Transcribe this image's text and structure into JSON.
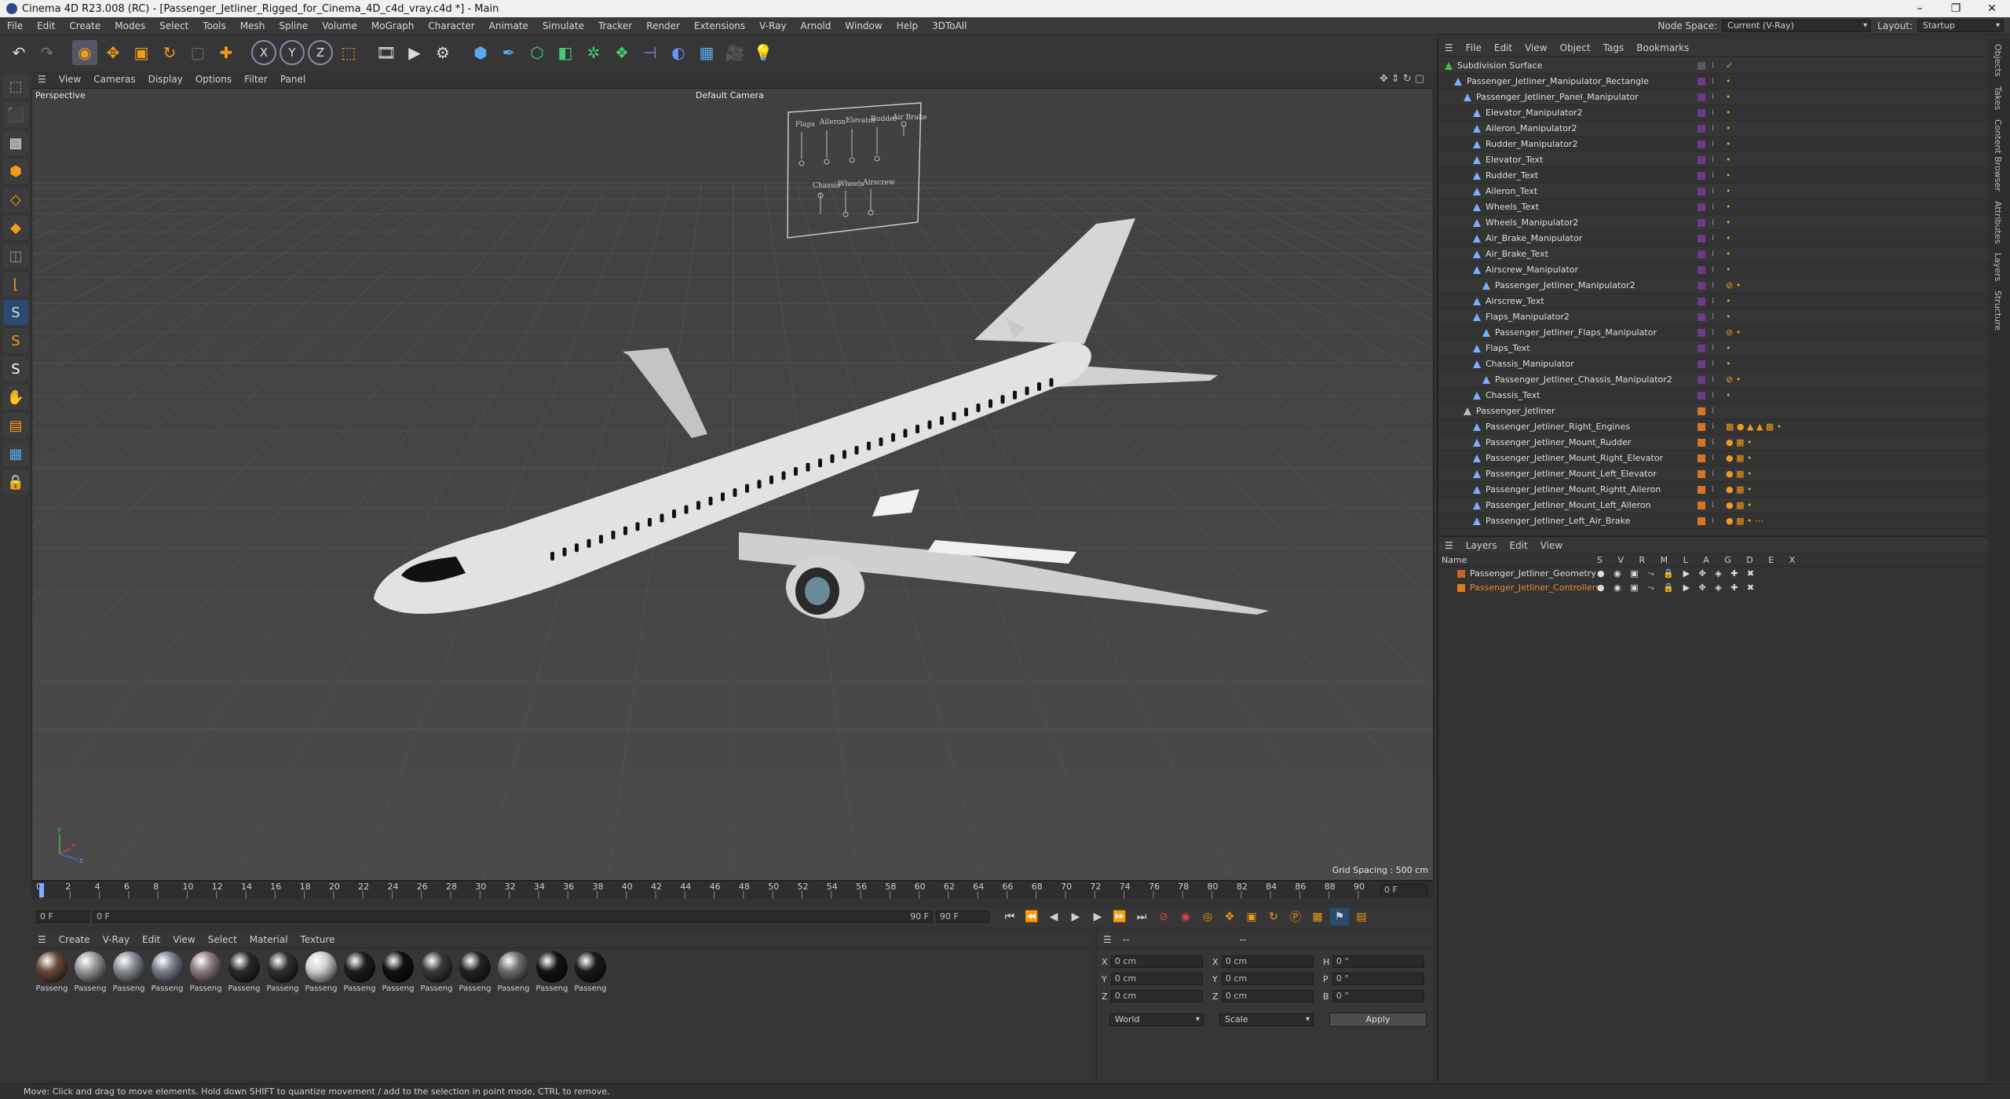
{
  "window": {
    "title": "Cinema 4D R23.008 (RC) - [Passenger_Jetliner_Rigged_for_Cinema_4D_c4d_vray.c4d *] - Main",
    "controls": [
      "–",
      "❐",
      "✕"
    ]
  },
  "menubar": {
    "items": [
      "File",
      "Edit",
      "Create",
      "Modes",
      "Select",
      "Tools",
      "Mesh",
      "Spline",
      "Volume",
      "MoGraph",
      "Character",
      "Animate",
      "Simulate",
      "Tracker",
      "Render",
      "Extensions",
      "V-Ray",
      "Arnold",
      "Window",
      "Help",
      "3DToAll"
    ],
    "node_space_label": "Node Space:",
    "node_space_value": "Current (V-Ray)",
    "layout_label": "Layout:",
    "layout_value": "Startup"
  },
  "viewport": {
    "menu": [
      "View",
      "Cameras",
      "Display",
      "Options",
      "Filter",
      "Panel"
    ],
    "mode": "Perspective",
    "camera": "Default Camera",
    "grid_spacing": "Grid Spacing : 500 cm",
    "panel_labels": [
      "Flaps",
      "Aileron",
      "Elevator",
      "Rudder",
      "Air Brake",
      "Chassis",
      "Wheels",
      "Airscrew"
    ]
  },
  "timeline": {
    "ticks": [
      "0",
      "2",
      "4",
      "6",
      "8",
      "10",
      "12",
      "14",
      "16",
      "18",
      "20",
      "22",
      "24",
      "26",
      "28",
      "30",
      "32",
      "34",
      "36",
      "38",
      "40",
      "42",
      "44",
      "46",
      "48",
      "50",
      "52",
      "54",
      "56",
      "58",
      "60",
      "62",
      "64",
      "66",
      "68",
      "70",
      "72",
      "74",
      "76",
      "78",
      "80",
      "82",
      "84",
      "86",
      "88",
      "90"
    ],
    "current_frame": "0 F",
    "start_field": "0 F",
    "preview_start": "0 F",
    "preview_end": "90 F",
    "end_field": "90 F"
  },
  "materials": {
    "menu": [
      "Create",
      "V-Ray",
      "Edit",
      "View",
      "Select",
      "Material",
      "Texture"
    ],
    "items": [
      {
        "label": "Passeng",
        "color": "#6a4a3c"
      },
      {
        "label": "Passeng",
        "color": "#9a9a9a"
      },
      {
        "label": "Passeng",
        "color": "#8a8e96"
      },
      {
        "label": "Passeng",
        "color": "#7c8290"
      },
      {
        "label": "Passeng",
        "color": "#8c7c80"
      },
      {
        "label": "Passeng",
        "color": "#2a2a2a"
      },
      {
        "label": "Passeng",
        "color": "#303030"
      },
      {
        "label": "Passeng",
        "color": "#cfcfcf"
      },
      {
        "label": "Passeng",
        "color": "#1e1e1e"
      },
      {
        "label": "Passeng",
        "color": "#101010"
      },
      {
        "label": "Passeng",
        "color": "#3a3a3a"
      },
      {
        "label": "Passeng",
        "color": "#242424"
      },
      {
        "label": "Passeng",
        "color": "#6e6e6e"
      },
      {
        "label": "Passeng",
        "color": "#141414"
      },
      {
        "label": "Passeng",
        "color": "#1a1a1a"
      }
    ]
  },
  "coordinates": {
    "header": "--",
    "header2": "--",
    "rows": [
      {
        "a1": "X",
        "v1": "0 cm",
        "a2": "X",
        "v2": "0 cm",
        "a3": "H",
        "v3": "0 °"
      },
      {
        "a1": "Y",
        "v1": "0 cm",
        "a2": "Y",
        "v2": "0 cm",
        "a3": "P",
        "v3": "0 °"
      },
      {
        "a1": "Z",
        "v1": "0 cm",
        "a2": "Z",
        "v2": "0 cm",
        "a3": "B",
        "v3": "0 °"
      }
    ],
    "space": "World",
    "mode": "Scale",
    "apply": "Apply"
  },
  "objects": {
    "menu": [
      "File",
      "Edit",
      "View",
      "Object",
      "Tags",
      "Bookmarks"
    ],
    "rows": [
      {
        "name": "Subdivision Surface",
        "depth": 0,
        "color": "#5a5a5a",
        "icon_color": "#3fbf3f",
        "tags": "✓"
      },
      {
        "name": "Passenger_Jetliner_Manipulator_Rectangle",
        "depth": 1,
        "color": "#6b3a8a",
        "icon_color": "#7ab0ff",
        "tags": "•"
      },
      {
        "name": "Passenger_Jetliner_Panel_Manipulator",
        "depth": 2,
        "color": "#6b3a8a",
        "icon_color": "#7ab0ff",
        "tags": "•"
      },
      {
        "name": "Elevator_Manipulator2",
        "depth": 3,
        "color": "#6b3a8a",
        "icon_color": "#7ab0ff",
        "tags": "•"
      },
      {
        "name": "Aileron_Manipulator2",
        "depth": 3,
        "color": "#6b3a8a",
        "icon_color": "#7ab0ff",
        "tags": "•"
      },
      {
        "name": "Rudder_Manipulator2",
        "depth": 3,
        "color": "#6b3a8a",
        "icon_color": "#7ab0ff",
        "tags": "•"
      },
      {
        "name": "Elevator_Text",
        "depth": 3,
        "color": "#6b3a8a",
        "icon_color": "#7ab0ff",
        "tags": "•"
      },
      {
        "name": "Rudder_Text",
        "depth": 3,
        "color": "#6b3a8a",
        "icon_color": "#7ab0ff",
        "tags": "•"
      },
      {
        "name": "Aileron_Text",
        "depth": 3,
        "color": "#6b3a8a",
        "icon_color": "#7ab0ff",
        "tags": "•"
      },
      {
        "name": "Wheels_Text",
        "depth": 3,
        "color": "#6b3a8a",
        "icon_color": "#7ab0ff",
        "tags": "•"
      },
      {
        "name": "Wheels_Manipulator2",
        "depth": 3,
        "color": "#6b3a8a",
        "icon_color": "#7ab0ff",
        "tags": "•"
      },
      {
        "name": "Air_Brake_Manipulator",
        "depth": 3,
        "color": "#6b3a8a",
        "icon_color": "#7ab0ff",
        "tags": "•"
      },
      {
        "name": "Air_Brake_Text",
        "depth": 3,
        "color": "#6b3a8a",
        "icon_color": "#7ab0ff",
        "tags": "•"
      },
      {
        "name": "Airscrew_Manipulator",
        "depth": 3,
        "color": "#6b3a8a",
        "icon_color": "#7ab0ff",
        "tags": "•"
      },
      {
        "name": "Passenger_Jetliner_Manipulator2",
        "depth": 4,
        "color": "#6b3a8a",
        "icon_color": "#7ab0ff",
        "tags": "⊘ •"
      },
      {
        "name": "Airscrew_Text",
        "depth": 3,
        "color": "#6b3a8a",
        "icon_color": "#7ab0ff",
        "tags": "•"
      },
      {
        "name": "Flaps_Manipulator2",
        "depth": 3,
        "color": "#6b3a8a",
        "icon_color": "#7ab0ff",
        "tags": "•"
      },
      {
        "name": "Passenger_Jetliner_Flaps_Manipulator",
        "depth": 4,
        "color": "#6b3a8a",
        "icon_color": "#7ab0ff",
        "tags": "⊘ •"
      },
      {
        "name": "Flaps_Text",
        "depth": 3,
        "color": "#6b3a8a",
        "icon_color": "#7ab0ff",
        "tags": "•"
      },
      {
        "name": "Chassis_Manipulator",
        "depth": 3,
        "color": "#6b3a8a",
        "icon_color": "#7ab0ff",
        "tags": "•"
      },
      {
        "name": "Passenger_Jetliner_Chassis_Manipulator2",
        "depth": 4,
        "color": "#6b3a8a",
        "icon_color": "#7ab0ff",
        "tags": "⊘ •"
      },
      {
        "name": "Chassis_Text",
        "depth": 3,
        "color": "#6b3a8a",
        "icon_color": "#7ab0ff",
        "tags": "•"
      },
      {
        "name": "Passenger_Jetliner",
        "depth": 2,
        "color": "#d8742a",
        "icon_color": "#bbbbbb",
        "tags": ""
      },
      {
        "name": "Passenger_Jetliner_Right_Engines",
        "depth": 3,
        "color": "#d8742a",
        "icon_color": "#7ab0ff",
        "tags": "▦ ● ▲ ▲ ▦ •"
      },
      {
        "name": "Passenger_Jetliner_Mount_Rudder",
        "depth": 3,
        "color": "#d8742a",
        "icon_color": "#7ab0ff",
        "tags": "● ▦ •"
      },
      {
        "name": "Passenger_Jetliner_Mount_Right_Elevator",
        "depth": 3,
        "color": "#d8742a",
        "icon_color": "#7ab0ff",
        "tags": "● ▦ •"
      },
      {
        "name": "Passenger_Jetliner_Mount_Left_Elevator",
        "depth": 3,
        "color": "#d8742a",
        "icon_color": "#7ab0ff",
        "tags": "● ▦ •"
      },
      {
        "name": "Passenger_Jetliner_Mount_Rightt_Aileron",
        "depth": 3,
        "color": "#d8742a",
        "icon_color": "#7ab0ff",
        "tags": "● ▦ •"
      },
      {
        "name": "Passenger_Jetliner_Mount_Left_Aileron",
        "depth": 3,
        "color": "#d8742a",
        "icon_color": "#7ab0ff",
        "tags": "● ▦ •"
      },
      {
        "name": "Passenger_Jetliner_Left_Air_Brake",
        "depth": 3,
        "color": "#d8742a",
        "icon_color": "#7ab0ff",
        "tags": "● ▦ • ⋯"
      }
    ]
  },
  "layers": {
    "menu": [
      "Layers",
      "Edit",
      "View"
    ],
    "name_header": "Name",
    "flag_header": "S V R M L A G D E X",
    "rows": [
      {
        "name": "Passenger_Jetliner_Geometry",
        "color": "#c8642a",
        "text_color": "#dedede"
      },
      {
        "name": "Passenger_Jetliner_Controllers",
        "color": "#e07a1a",
        "text_color": "#f0882a"
      }
    ]
  },
  "side_tabs": [
    "Objects",
    "Takes",
    "Content Browser",
    "Attributes",
    "Layers",
    "Structure"
  ],
  "status": "Move: Click and drag to move elements. Hold down SHIFT to quantize movement / add to the selection in point mode, CTRL to remove."
}
